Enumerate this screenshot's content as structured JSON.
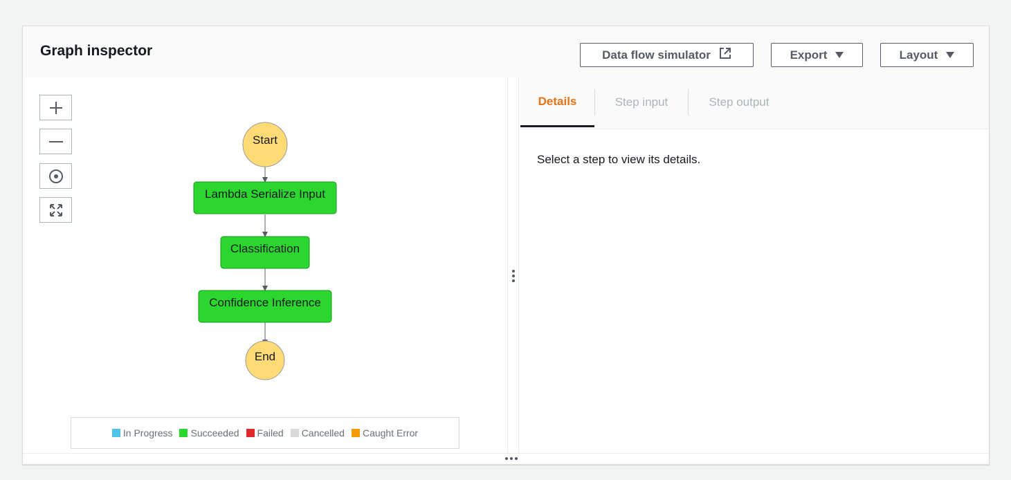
{
  "header": {
    "title": "Graph inspector",
    "buttons": {
      "simulator": "Data flow simulator",
      "export": "Export",
      "layout": "Layout"
    }
  },
  "graph": {
    "nodes": [
      {
        "label": "Start",
        "shape": "circle",
        "status": "not-started"
      },
      {
        "label": "Lambda Serialize Input",
        "shape": "rect",
        "status": "succeeded"
      },
      {
        "label": "Classification",
        "shape": "rect",
        "status": "succeeded"
      },
      {
        "label": "Confidence Inference",
        "shape": "rect",
        "status": "succeeded"
      },
      {
        "label": "End",
        "shape": "circle",
        "status": "not-started"
      }
    ],
    "zoom_controls": [
      "zoom-in-icon",
      "zoom-out-icon",
      "center-icon",
      "fit-icon"
    ]
  },
  "legend": [
    {
      "label": "In Progress",
      "color": "#4dc3e8"
    },
    {
      "label": "Succeeded",
      "color": "#2bd62e"
    },
    {
      "label": "Failed",
      "color": "#de2a2a"
    },
    {
      "label": "Cancelled",
      "color": "#d9d9d9"
    },
    {
      "label": "Caught Error",
      "color": "#f59b0a"
    }
  ],
  "colors": {
    "succeeded": "#2bd62e",
    "endpoint": "#ffda75",
    "accent": "#ec7211"
  },
  "details": {
    "tabs": [
      {
        "label": "Details",
        "active": true
      },
      {
        "label": "Step input",
        "active": false
      },
      {
        "label": "Step output",
        "active": false
      }
    ],
    "empty_message": "Select a step to view its details."
  }
}
